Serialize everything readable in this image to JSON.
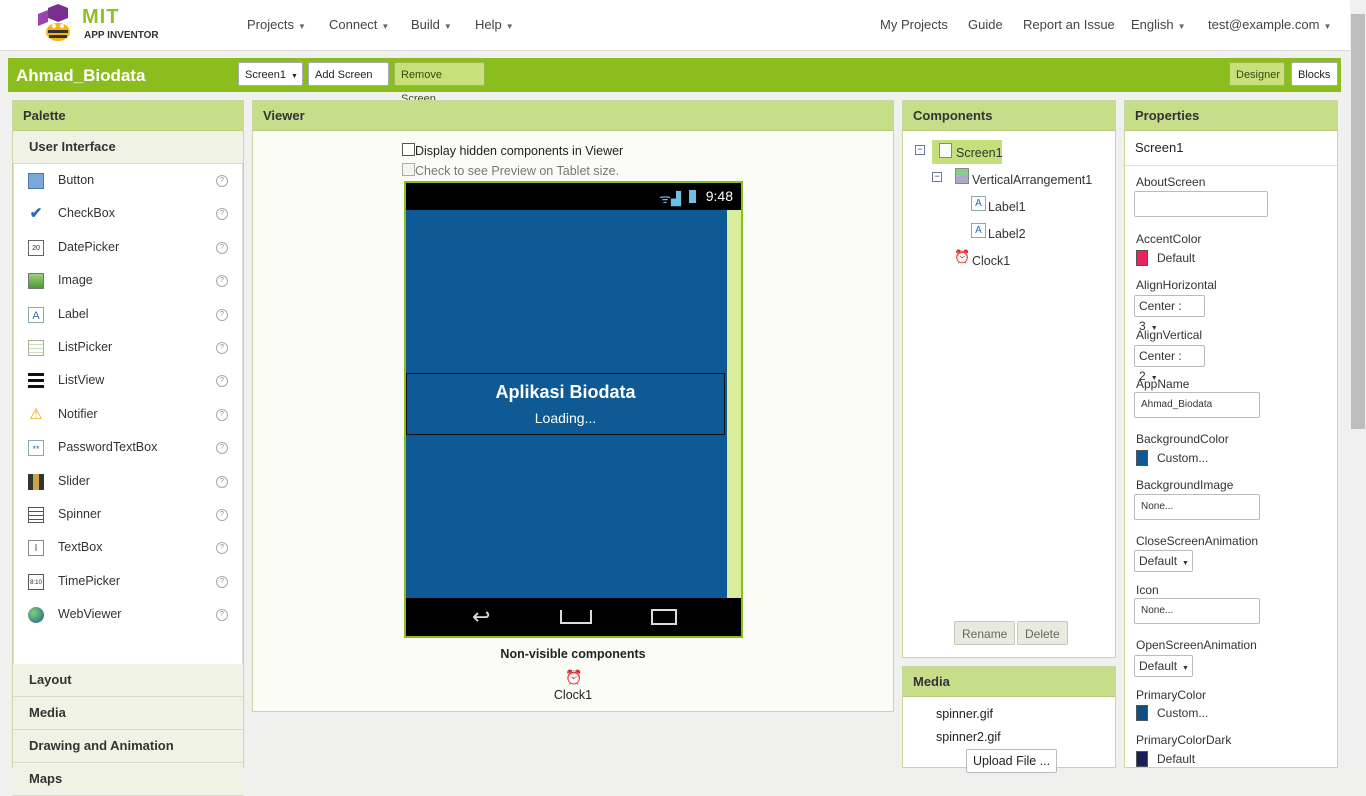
{
  "header": {
    "logo_main": "MIT",
    "logo_sub": "APP INVENTOR",
    "menus": [
      "Projects",
      "Connect",
      "Build",
      "Help"
    ],
    "right_links": [
      "My Projects",
      "Guide",
      "Report an Issue",
      "English",
      "test@example.com"
    ]
  },
  "project": {
    "name": "Ahmad_Biodata",
    "screen_select": "Screen1",
    "add_screen": "Add Screen ...",
    "remove_screen": "Remove Screen",
    "designer": "Designer",
    "blocks": "Blocks"
  },
  "palette": {
    "title": "Palette",
    "open_category": "User Interface",
    "items": [
      {
        "label": "Button",
        "icon": "button-icon"
      },
      {
        "label": "CheckBox",
        "icon": "checkbox-icon"
      },
      {
        "label": "DatePicker",
        "icon": "datepicker-icon"
      },
      {
        "label": "Image",
        "icon": "image-icon"
      },
      {
        "label": "Label",
        "icon": "label-icon"
      },
      {
        "label": "ListPicker",
        "icon": "listpicker-icon"
      },
      {
        "label": "ListView",
        "icon": "listview-icon"
      },
      {
        "label": "Notifier",
        "icon": "notifier-icon"
      },
      {
        "label": "PasswordTextBox",
        "icon": "passwordtextbox-icon"
      },
      {
        "label": "Slider",
        "icon": "slider-icon"
      },
      {
        "label": "Spinner",
        "icon": "spinner-icon"
      },
      {
        "label": "TextBox",
        "icon": "textbox-icon"
      },
      {
        "label": "TimePicker",
        "icon": "timepicker-icon"
      },
      {
        "label": "WebViewer",
        "icon": "webviewer-icon"
      }
    ],
    "help_glyph": "?",
    "categories": [
      "Layout",
      "Media",
      "Drawing and Animation",
      "Maps"
    ]
  },
  "viewer": {
    "title": "Viewer",
    "hidden_checkbox": "Display hidden components in Viewer",
    "tablet_checkbox": "Check to see Preview on Tablet size.",
    "phone_time": "9:48",
    "app_title": "Aplikasi Biodata",
    "app_loading": "Loading...",
    "nonvisible_title": "Non-visible components",
    "nonvisible_item": "Clock1",
    "phone_bg": "#0d5a96"
  },
  "components": {
    "title": "Components",
    "tree": [
      "Screen1",
      "VerticalArrangement1",
      "Label1",
      "Label2",
      "Clock1"
    ],
    "rename": "Rename",
    "delete": "Delete"
  },
  "media": {
    "title": "Media",
    "files": [
      "spinner.gif",
      "spinner2.gif"
    ],
    "upload": "Upload File ..."
  },
  "properties": {
    "title": "Properties",
    "component": "Screen1",
    "about_label": "AboutScreen",
    "about_value": "",
    "accent_label": "AccentColor",
    "accent_value": "Default",
    "accent_color": "#e8245a",
    "alignh_label": "AlignHorizontal",
    "alignh_value": "Center : 3",
    "alignv_label": "AlignVertical",
    "alignv_value": "Center : 2",
    "appname_label": "AppName",
    "appname_value": "Ahmad_Biodata",
    "bgcolor_label": "BackgroundColor",
    "bgcolor_value": "Custom...",
    "bgcolor_color": "#0d5a96",
    "bgimage_label": "BackgroundImage",
    "bgimage_value": "None...",
    "closeanim_label": "CloseScreenAnimation",
    "closeanim_value": "Default",
    "icon_label": "Icon",
    "icon_value": "None...",
    "openanim_label": "OpenScreenAnimation",
    "openanim_value": "Default",
    "primary_label": "PrimaryColor",
    "primary_value": "Custom...",
    "primary_color": "#0d4f7e",
    "primarydark_label": "PrimaryColorDark",
    "primarydark_value": "Default",
    "primarydark_color": "#1a1f5c"
  }
}
